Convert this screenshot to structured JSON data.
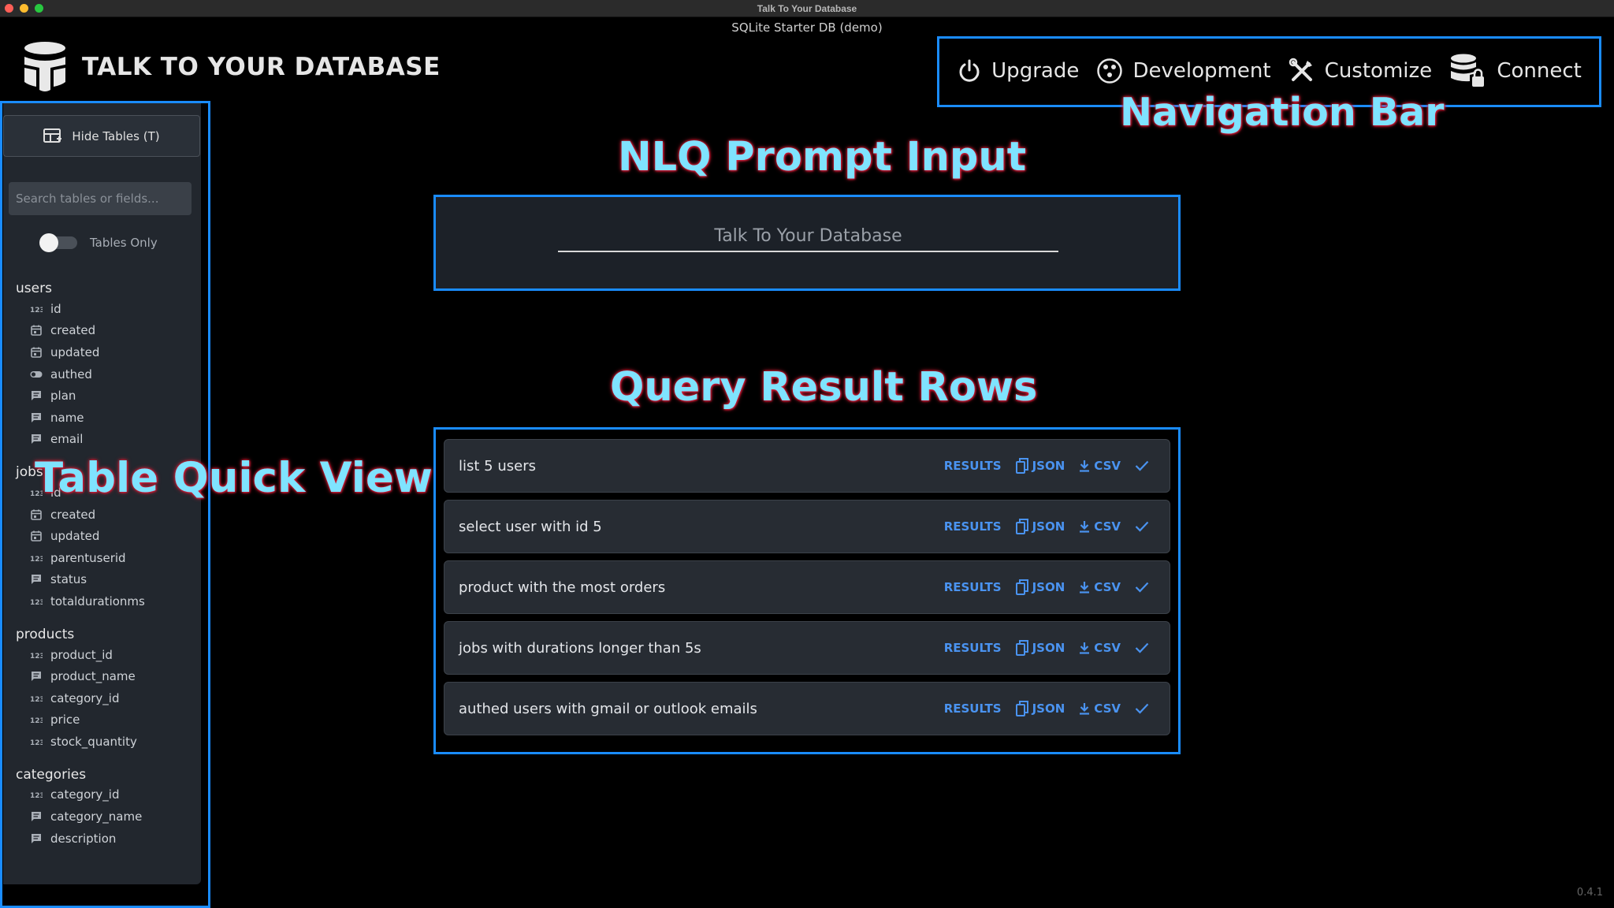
{
  "window": {
    "title": "Talk To Your Database",
    "subtitle": "SQLite Starter DB (demo)",
    "colors": {
      "close": "#ff5f57",
      "minimize": "#febc2e",
      "zoom": "#28c840"
    }
  },
  "logo": {
    "text": "TALK TO YOUR DATABASE"
  },
  "nav": {
    "items": [
      {
        "label": "Upgrade",
        "icon": "power-icon"
      },
      {
        "label": "Development",
        "icon": "development-icon"
      },
      {
        "label": "Customize",
        "icon": "tools-icon"
      },
      {
        "label": "Connect",
        "icon": "database-lock-icon"
      }
    ]
  },
  "annotations": {
    "nav": "Navigation Bar",
    "prompt": "NLQ Prompt Input",
    "results": "Query Result Rows",
    "sidebar": "Table Quick View"
  },
  "sidebar": {
    "hide_label": "Hide Tables (T)",
    "search_placeholder": "Search tables or fields...",
    "toggle_label": "Tables Only",
    "tables": [
      {
        "name": "users",
        "fields": [
          {
            "name": "id",
            "type": "number"
          },
          {
            "name": "created",
            "type": "date"
          },
          {
            "name": "updated",
            "type": "date"
          },
          {
            "name": "authed",
            "type": "bool"
          },
          {
            "name": "plan",
            "type": "text"
          },
          {
            "name": "name",
            "type": "text"
          },
          {
            "name": "email",
            "type": "text"
          }
        ]
      },
      {
        "name": "jobs",
        "fields": [
          {
            "name": "id",
            "type": "number"
          },
          {
            "name": "created",
            "type": "date"
          },
          {
            "name": "updated",
            "type": "date"
          },
          {
            "name": "parentuserid",
            "type": "number"
          },
          {
            "name": "status",
            "type": "text"
          },
          {
            "name": "totaldurationms",
            "type": "number"
          }
        ]
      },
      {
        "name": "products",
        "fields": [
          {
            "name": "product_id",
            "type": "number"
          },
          {
            "name": "product_name",
            "type": "text"
          },
          {
            "name": "category_id",
            "type": "number"
          },
          {
            "name": "price",
            "type": "number"
          },
          {
            "name": "stock_quantity",
            "type": "number"
          }
        ]
      },
      {
        "name": "categories",
        "fields": [
          {
            "name": "category_id",
            "type": "number"
          },
          {
            "name": "category_name",
            "type": "text"
          },
          {
            "name": "description",
            "type": "text"
          }
        ]
      }
    ]
  },
  "prompt": {
    "placeholder": "Talk To Your Database"
  },
  "results": {
    "actions": {
      "results": "RESULTS",
      "json": "JSON",
      "csv": "CSV"
    },
    "rows": [
      "list 5 users",
      "select user with id 5",
      "product with the most orders",
      "jobs with durations longer than 5s",
      "authed users with gmail or outlook emails"
    ]
  },
  "version": "0.4.1"
}
